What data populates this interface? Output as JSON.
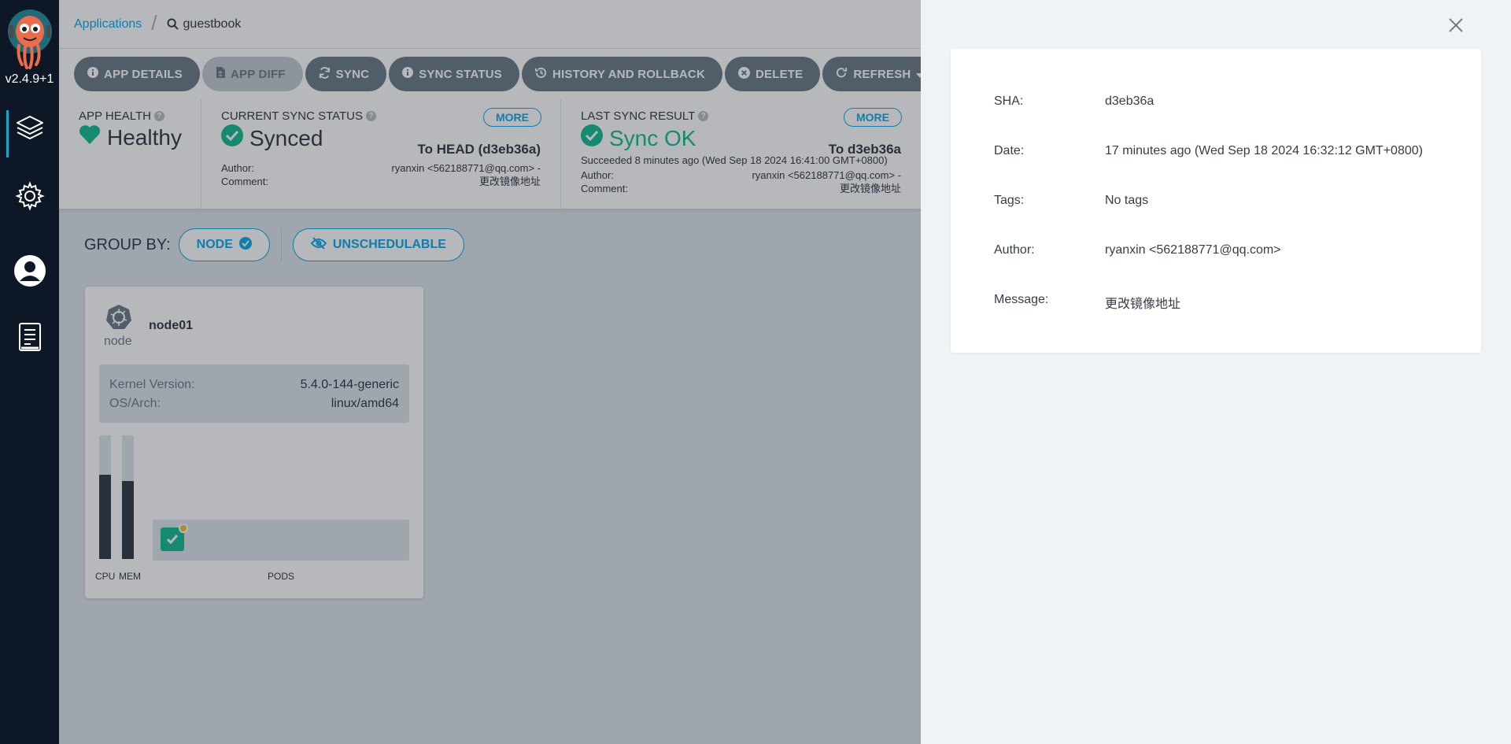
{
  "sidebar": {
    "version": "v2.4.9+1",
    "nav": [
      {
        "icon": "layers-icon",
        "active": true
      },
      {
        "icon": "gear-icon",
        "active": false
      },
      {
        "icon": "user-icon",
        "active": false
      },
      {
        "icon": "docs-icon",
        "active": false
      }
    ]
  },
  "breadcrumb": {
    "root": "Applications",
    "current": "guestbook"
  },
  "toolbar": {
    "app_details": "APP DETAILS",
    "app_diff": "APP DIFF",
    "sync": "SYNC",
    "sync_status": "SYNC STATUS",
    "history": "HISTORY AND ROLLBACK",
    "delete": "DELETE",
    "refresh": "REFRESH"
  },
  "status": {
    "health": {
      "title": "APP HEALTH",
      "value": "Healthy",
      "color": "#18be94"
    },
    "current_sync": {
      "title": "CURRENT SYNC STATUS",
      "more": "MORE",
      "value": "Synced",
      "target": "To HEAD (d3eb36a)",
      "author_label": "Author:",
      "author": "ryanxin <562188771@qq.com> -",
      "comment_label": "Comment:",
      "comment": "更改镜像地址"
    },
    "last_sync": {
      "title": "LAST SYNC RESULT",
      "more": "MORE",
      "value": "Sync OK",
      "target": "To d3eb36a",
      "succeeded": "Succeeded 8 minutes ago (Wed Sep 18 2024 16:41:00 GMT+0800)",
      "author_label": "Author:",
      "author": "ryanxin <562188771@qq.com> -",
      "comment_label": "Comment:",
      "comment": "更改镜像地址"
    }
  },
  "groupby": {
    "label": "GROUP BY:",
    "node": "NODE",
    "unschedulable": "UNSCHEDULABLE"
  },
  "node": {
    "type": "node",
    "name": "node01",
    "kernel_label": "Kernel Version:",
    "kernel": "5.4.0-144-generic",
    "os_label": "OS/Arch:",
    "os": "linux/amd64",
    "cpu_label": "CPU",
    "mem_label": "MEM",
    "pods_label": "PODS",
    "cpu_fraction": 0.68,
    "mem_fraction": 0.63
  },
  "revision": {
    "sha_label": "SHA:",
    "sha": "d3eb36a",
    "date_label": "Date:",
    "date": "17 minutes ago (Wed Sep 18 2024 16:32:12 GMT+0800)",
    "tags_label": "Tags:",
    "tags": "No tags",
    "author_label": "Author:",
    "author": "ryanxin <562188771@qq.com>",
    "message_label": "Message:",
    "message": "更改镜像地址"
  },
  "colors": {
    "accent": "#0dadea",
    "success": "#18be94",
    "button": "#6d7f8b"
  }
}
